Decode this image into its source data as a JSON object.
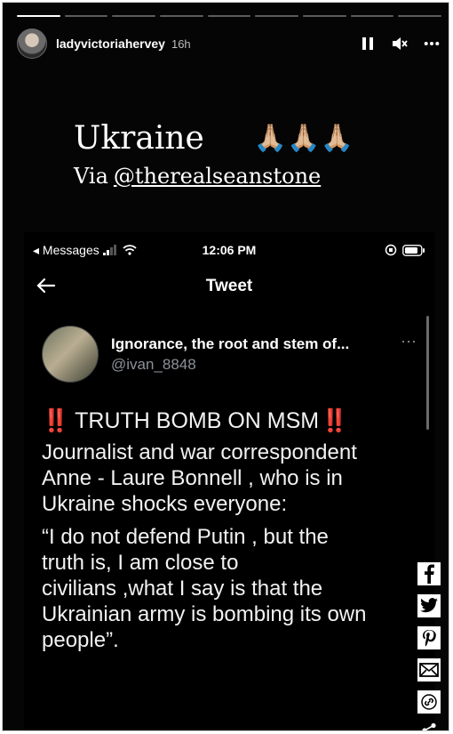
{
  "story": {
    "username": "ladyvictoriahervey",
    "time": "16h",
    "segments": 9,
    "caption": {
      "title": "Ukraine",
      "emoji": "🙏🏼🙏🏼🙏🏼",
      "via_prefix": "Via",
      "via_handle": "@therealseanstone"
    }
  },
  "screenshot": {
    "status": {
      "back_app": "◂ Messages",
      "clock": "12:06 PM"
    },
    "nav": {
      "title": "Tweet"
    },
    "tweet": {
      "name": "Ignorance, the root and stem of...",
      "handle": "@ivan_8848",
      "more": "···",
      "headline": "TRUTH BOMB ON MSM",
      "bang": "‼️",
      "paragraph1": "Journalist and war correspondent\nAnne - Laure Bonnell ,  who is in\nUkraine shocks everyone:",
      "paragraph2": "“I do not defend Putin , but the\ntruth is, I am close to\ncivilians ,what I say is that the\nUkrainian army is bombing its own\npeople”."
    }
  },
  "share_icons": [
    "facebook-icon",
    "twitter-icon",
    "pinterest-icon",
    "mail-icon",
    "link-icon",
    "share-icon"
  ],
  "colors": {
    "background": "#050505",
    "text": "#ffffff",
    "muted": "#8b9199",
    "alert": "#e0322d"
  }
}
